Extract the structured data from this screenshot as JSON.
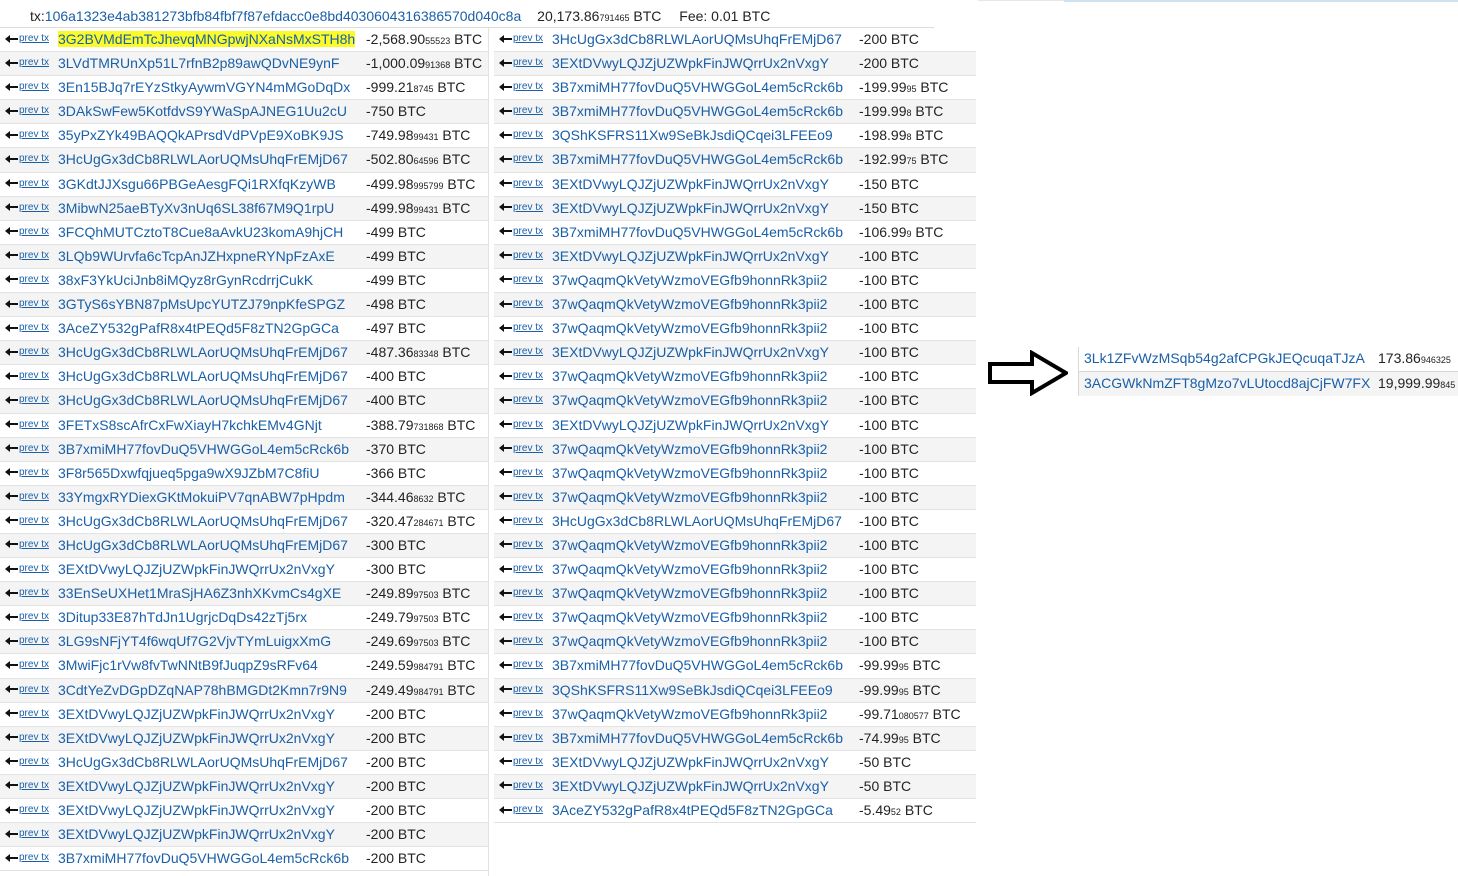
{
  "header": {
    "tx_label": "tx:",
    "tx_hash": "106a1323e4ab381273bfb84fbf7f87efdacc0e8bd4030604316386570d040c8a",
    "total_main": "20,173.86",
    "total_small": "791465",
    "total_unit": " BTC",
    "fee": "Fee: 0.01 BTC"
  },
  "prev_label": "prev tx",
  "inputs_left": [
    {
      "addr": "3G2BVMdEmTcJhevqMNGpwjNXaNsMxSTH8h",
      "main": "-2,568.90",
      "small": "55523",
      "unit": " BTC",
      "highlight": true
    },
    {
      "addr": "3LVdTMRUnXp51L7rfnB2p89awQDvNE9ynF",
      "main": "-1,000.09",
      "small": "91368",
      "unit": " BTC"
    },
    {
      "addr": "3En15BJq7rEYzStkyAywmVGYN4mMGoDqDx",
      "main": "-999.21",
      "small": "8745",
      "unit": " BTC"
    },
    {
      "addr": "3DAkSwFew5KotfdvS9YWaSpAJNEG1Uu2cU",
      "main": "-750",
      "small": "",
      "unit": " BTC"
    },
    {
      "addr": "35yPxZYk49BAQQkAPrsdVdPVpE9XoBK9JS",
      "main": "-749.98",
      "small": "99431",
      "unit": " BTC"
    },
    {
      "addr": "3HcUgGx3dCb8RLWLAorUQMsUhqFrEMjD67",
      "main": "-502.80",
      "small": "64596",
      "unit": " BTC"
    },
    {
      "addr": "3GKdtJJXsgu66PBGeAesgFQi1RXfqKzyWB",
      "main": "-499.98",
      "small": "995799",
      "unit": " BTC"
    },
    {
      "addr": "3MibwN25aeBTyXv3nUq6SL38f67M9Q1rpU",
      "main": "-499.98",
      "small": "99431",
      "unit": " BTC"
    },
    {
      "addr": "3FCQhMUTCztoT8Cue8aAvkU23komA9hjCH",
      "main": "-499",
      "small": "",
      "unit": " BTC"
    },
    {
      "addr": "3LQb9WUrvfa6cTcpAnJZHxpneRYNpFzAxE",
      "main": "-499",
      "small": "",
      "unit": " BTC"
    },
    {
      "addr": "38xF3YkUciJnb8iMQyz8rGynRcdrrjCukK",
      "main": "-499",
      "small": "",
      "unit": " BTC"
    },
    {
      "addr": "3GTyS6sYBN87pMsUpcYUTZJ79npKfeSPGZ",
      "main": "-498",
      "small": "",
      "unit": " BTC"
    },
    {
      "addr": "3AceZY532gPafR8x4tPEQd5F8zTN2GpGCa",
      "main": "-497",
      "small": "",
      "unit": " BTC"
    },
    {
      "addr": "3HcUgGx3dCb8RLWLAorUQMsUhqFrEMjD67",
      "main": "-487.36",
      "small": "83348",
      "unit": " BTC"
    },
    {
      "addr": "3HcUgGx3dCb8RLWLAorUQMsUhqFrEMjD67",
      "main": "-400",
      "small": "",
      "unit": " BTC"
    },
    {
      "addr": "3HcUgGx3dCb8RLWLAorUQMsUhqFrEMjD67",
      "main": "-400",
      "small": "",
      "unit": " BTC"
    },
    {
      "addr": "3FETxS8scAfrCxFwXiayH7kchkEMv4GNjt",
      "main": "-388.79",
      "small": "731868",
      "unit": " BTC"
    },
    {
      "addr": "3B7xmiMH77fovDuQ5VHWGGoL4em5cRck6b",
      "main": "-370",
      "small": "",
      "unit": " BTC"
    },
    {
      "addr": "3F8r565Dxwfqjueq5pga9wX9JZbM7C8fiU",
      "main": "-366",
      "small": "",
      "unit": " BTC"
    },
    {
      "addr": "33YmgxRYDiexGKtMokuiPV7qnABW7pHpdm",
      "main": "-344.46",
      "small": "8632",
      "unit": " BTC"
    },
    {
      "addr": "3HcUgGx3dCb8RLWLAorUQMsUhqFrEMjD67",
      "main": "-320.47",
      "small": "284671",
      "unit": " BTC"
    },
    {
      "addr": "3HcUgGx3dCb8RLWLAorUQMsUhqFrEMjD67",
      "main": "-300",
      "small": "",
      "unit": " BTC"
    },
    {
      "addr": "3EXtDVwyLQJZjUZWpkFinJWQrrUx2nVxgY",
      "main": "-300",
      "small": "",
      "unit": " BTC"
    },
    {
      "addr": "33EnSeUXHet1MraSjHA6Z3nhXKvmCs4gXE",
      "main": "-249.89",
      "small": "97503",
      "unit": " BTC"
    },
    {
      "addr": "3Ditup33E87hTdJn1UgrjcDqDs42zTj5rx",
      "main": "-249.79",
      "small": "97503",
      "unit": " BTC"
    },
    {
      "addr": "3LG9sNFjYT4f6wqUf7G2VjvTYmLuigxXmG",
      "main": "-249.69",
      "small": "97503",
      "unit": " BTC"
    },
    {
      "addr": "3MwiFjc1rVw8fvTwNNtB9fJuqpZ9sRFv64",
      "main": "-249.59",
      "small": "984791",
      "unit": " BTC"
    },
    {
      "addr": "3CdtYeZvDGpDZqNAP78hBMGDt2Kmn7r9N9",
      "main": "-249.49",
      "small": "984791",
      "unit": " BTC"
    },
    {
      "addr": "3EXtDVwyLQJZjUZWpkFinJWQrrUx2nVxgY",
      "main": "-200",
      "small": "",
      "unit": " BTC"
    },
    {
      "addr": "3EXtDVwyLQJZjUZWpkFinJWQrrUx2nVxgY",
      "main": "-200",
      "small": "",
      "unit": " BTC"
    },
    {
      "addr": "3HcUgGx3dCb8RLWLAorUQMsUhqFrEMjD67",
      "main": "-200",
      "small": "",
      "unit": " BTC"
    },
    {
      "addr": "3EXtDVwyLQJZjUZWpkFinJWQrrUx2nVxgY",
      "main": "-200",
      "small": "",
      "unit": " BTC"
    },
    {
      "addr": "3EXtDVwyLQJZjUZWpkFinJWQrrUx2nVxgY",
      "main": "-200",
      "small": "",
      "unit": " BTC"
    },
    {
      "addr": "3EXtDVwyLQJZjUZWpkFinJWQrrUx2nVxgY",
      "main": "-200",
      "small": "",
      "unit": " BTC"
    },
    {
      "addr": "3B7xmiMH77fovDuQ5VHWGGoL4em5cRck6b",
      "main": "-200",
      "small": "",
      "unit": " BTC"
    }
  ],
  "inputs_mid": [
    {
      "addr": "3HcUgGx3dCb8RLWLAorUQMsUhqFrEMjD67",
      "main": "-200",
      "small": "",
      "unit": " BTC"
    },
    {
      "addr": "3EXtDVwyLQJZjUZWpkFinJWQrrUx2nVxgY",
      "main": "-200",
      "small": "",
      "unit": " BTC"
    },
    {
      "addr": "3B7xmiMH77fovDuQ5VHWGGoL4em5cRck6b",
      "main": "-199.99",
      "small": "95",
      "unit": " BTC"
    },
    {
      "addr": "3B7xmiMH77fovDuQ5VHWGGoL4em5cRck6b",
      "main": "-199.99",
      "small": "8",
      "unit": " BTC"
    },
    {
      "addr": "3QShKSFRS11Xw9SeBkJsdiQCqei3LFEEo9",
      "main": "-198.99",
      "small": "8",
      "unit": " BTC"
    },
    {
      "addr": "3B7xmiMH77fovDuQ5VHWGGoL4em5cRck6b",
      "main": "-192.99",
      "small": "75",
      "unit": " BTC"
    },
    {
      "addr": "3EXtDVwyLQJZjUZWpkFinJWQrrUx2nVxgY",
      "main": "-150",
      "small": "",
      "unit": " BTC"
    },
    {
      "addr": "3EXtDVwyLQJZjUZWpkFinJWQrrUx2nVxgY",
      "main": "-150",
      "small": "",
      "unit": " BTC"
    },
    {
      "addr": "3B7xmiMH77fovDuQ5VHWGGoL4em5cRck6b",
      "main": "-106.99",
      "small": "9",
      "unit": " BTC"
    },
    {
      "addr": "3EXtDVwyLQJZjUZWpkFinJWQrrUx2nVxgY",
      "main": "-100",
      "small": "",
      "unit": " BTC"
    },
    {
      "addr": "37wQaqmQkVetyWzmoVEGfb9honnRk3pii2",
      "main": "-100",
      "small": "",
      "unit": " BTC"
    },
    {
      "addr": "37wQaqmQkVetyWzmoVEGfb9honnRk3pii2",
      "main": "-100",
      "small": "",
      "unit": " BTC"
    },
    {
      "addr": "37wQaqmQkVetyWzmoVEGfb9honnRk3pii2",
      "main": "-100",
      "small": "",
      "unit": " BTC"
    },
    {
      "addr": "3EXtDVwyLQJZjUZWpkFinJWQrrUx2nVxgY",
      "main": "-100",
      "small": "",
      "unit": " BTC"
    },
    {
      "addr": "37wQaqmQkVetyWzmoVEGfb9honnRk3pii2",
      "main": "-100",
      "small": "",
      "unit": " BTC"
    },
    {
      "addr": "37wQaqmQkVetyWzmoVEGfb9honnRk3pii2",
      "main": "-100",
      "small": "",
      "unit": " BTC"
    },
    {
      "addr": "3EXtDVwyLQJZjUZWpkFinJWQrrUx2nVxgY",
      "main": "-100",
      "small": "",
      "unit": " BTC"
    },
    {
      "addr": "37wQaqmQkVetyWzmoVEGfb9honnRk3pii2",
      "main": "-100",
      "small": "",
      "unit": " BTC"
    },
    {
      "addr": "37wQaqmQkVetyWzmoVEGfb9honnRk3pii2",
      "main": "-100",
      "small": "",
      "unit": " BTC"
    },
    {
      "addr": "37wQaqmQkVetyWzmoVEGfb9honnRk3pii2",
      "main": "-100",
      "small": "",
      "unit": " BTC"
    },
    {
      "addr": "3HcUgGx3dCb8RLWLAorUQMsUhqFrEMjD67",
      "main": "-100",
      "small": "",
      "unit": " BTC"
    },
    {
      "addr": "37wQaqmQkVetyWzmoVEGfb9honnRk3pii2",
      "main": "-100",
      "small": "",
      "unit": " BTC"
    },
    {
      "addr": "37wQaqmQkVetyWzmoVEGfb9honnRk3pii2",
      "main": "-100",
      "small": "",
      "unit": " BTC"
    },
    {
      "addr": "37wQaqmQkVetyWzmoVEGfb9honnRk3pii2",
      "main": "-100",
      "small": "",
      "unit": " BTC"
    },
    {
      "addr": "37wQaqmQkVetyWzmoVEGfb9honnRk3pii2",
      "main": "-100",
      "small": "",
      "unit": " BTC"
    },
    {
      "addr": "37wQaqmQkVetyWzmoVEGfb9honnRk3pii2",
      "main": "-100",
      "small": "",
      "unit": " BTC"
    },
    {
      "addr": "3B7xmiMH77fovDuQ5VHWGGoL4em5cRck6b",
      "main": "-99.99",
      "small": "95",
      "unit": " BTC"
    },
    {
      "addr": "3QShKSFRS11Xw9SeBkJsdiQCqei3LFEEo9",
      "main": "-99.99",
      "small": "95",
      "unit": " BTC"
    },
    {
      "addr": "37wQaqmQkVetyWzmoVEGfb9honnRk3pii2",
      "main": "-99.71",
      "small": "080577",
      "unit": " BTC"
    },
    {
      "addr": "3B7xmiMH77fovDuQ5VHWGGoL4em5cRck6b",
      "main": "-74.99",
      "small": "95",
      "unit": " BTC"
    },
    {
      "addr": "3EXtDVwyLQJZjUZWpkFinJWQrrUx2nVxgY",
      "main": "-50",
      "small": "",
      "unit": " BTC"
    },
    {
      "addr": "3EXtDVwyLQJZjUZWpkFinJWQrrUx2nVxgY",
      "main": "-50",
      "small": "",
      "unit": " BTC"
    },
    {
      "addr": "3AceZY532gPafR8x4tPEQd5F8zTN2GpGCa",
      "main": "-5.49",
      "small": "52",
      "unit": " BTC"
    }
  ],
  "outputs": [
    {
      "addr": "3Lk1ZFvWzMSqb54g2afCPGkJEQcuqaTJzA",
      "main": "173.86",
      "small": "946325"
    },
    {
      "addr": "3ACGWkNmZFT8gMzo7vLUtocd8ajCjFW7FX",
      "main": "19,999.99",
      "small": "845"
    }
  ]
}
